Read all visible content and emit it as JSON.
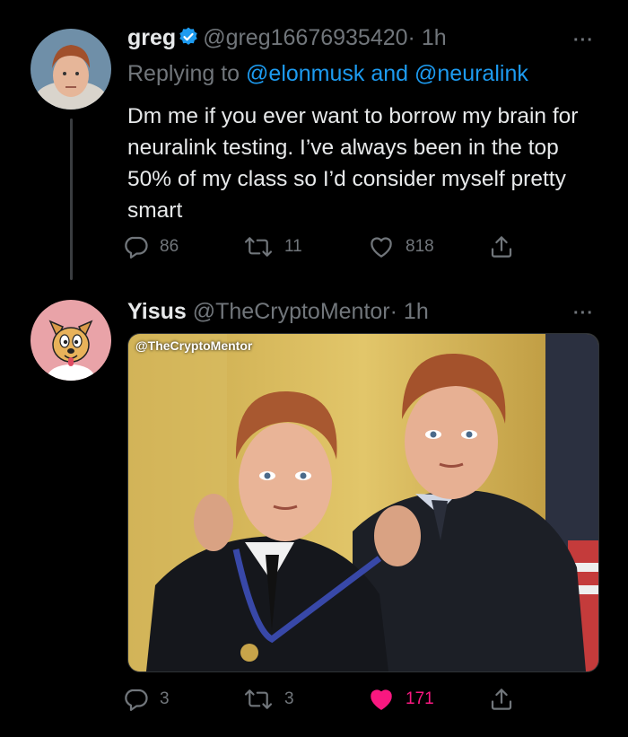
{
  "tweet1": {
    "name": "greg",
    "handle": "@greg16676935420",
    "time": "· 1h",
    "reply_prefix": "Replying to ",
    "reply_user1": "@elonmusk",
    "reply_and": " and ",
    "reply_user2": "@neuralink",
    "text": "Dm me if you ever want to borrow my brain for neuralink testing. I’ve always been in the top 50% of my class so I’d consider myself pretty smart",
    "replies": "86",
    "retweets": "11",
    "likes": "818",
    "more": "···"
  },
  "tweet2": {
    "name": "Yisus",
    "handle": "@TheCryptoMentor",
    "time": "· 1h",
    "media_label": "@TheCryptoMentor",
    "replies": "3",
    "retweets": "3",
    "likes": "171",
    "more": "···"
  },
  "icons": {
    "verified": "verified-badge-icon",
    "reply": "reply-icon",
    "retweet": "retweet-icon",
    "like": "heart-icon",
    "share": "share-icon"
  },
  "colors": {
    "background": "#000000",
    "text": "#e7e9ea",
    "muted": "#71767b",
    "link": "#1d9bf0",
    "like_active": "#f91880"
  }
}
